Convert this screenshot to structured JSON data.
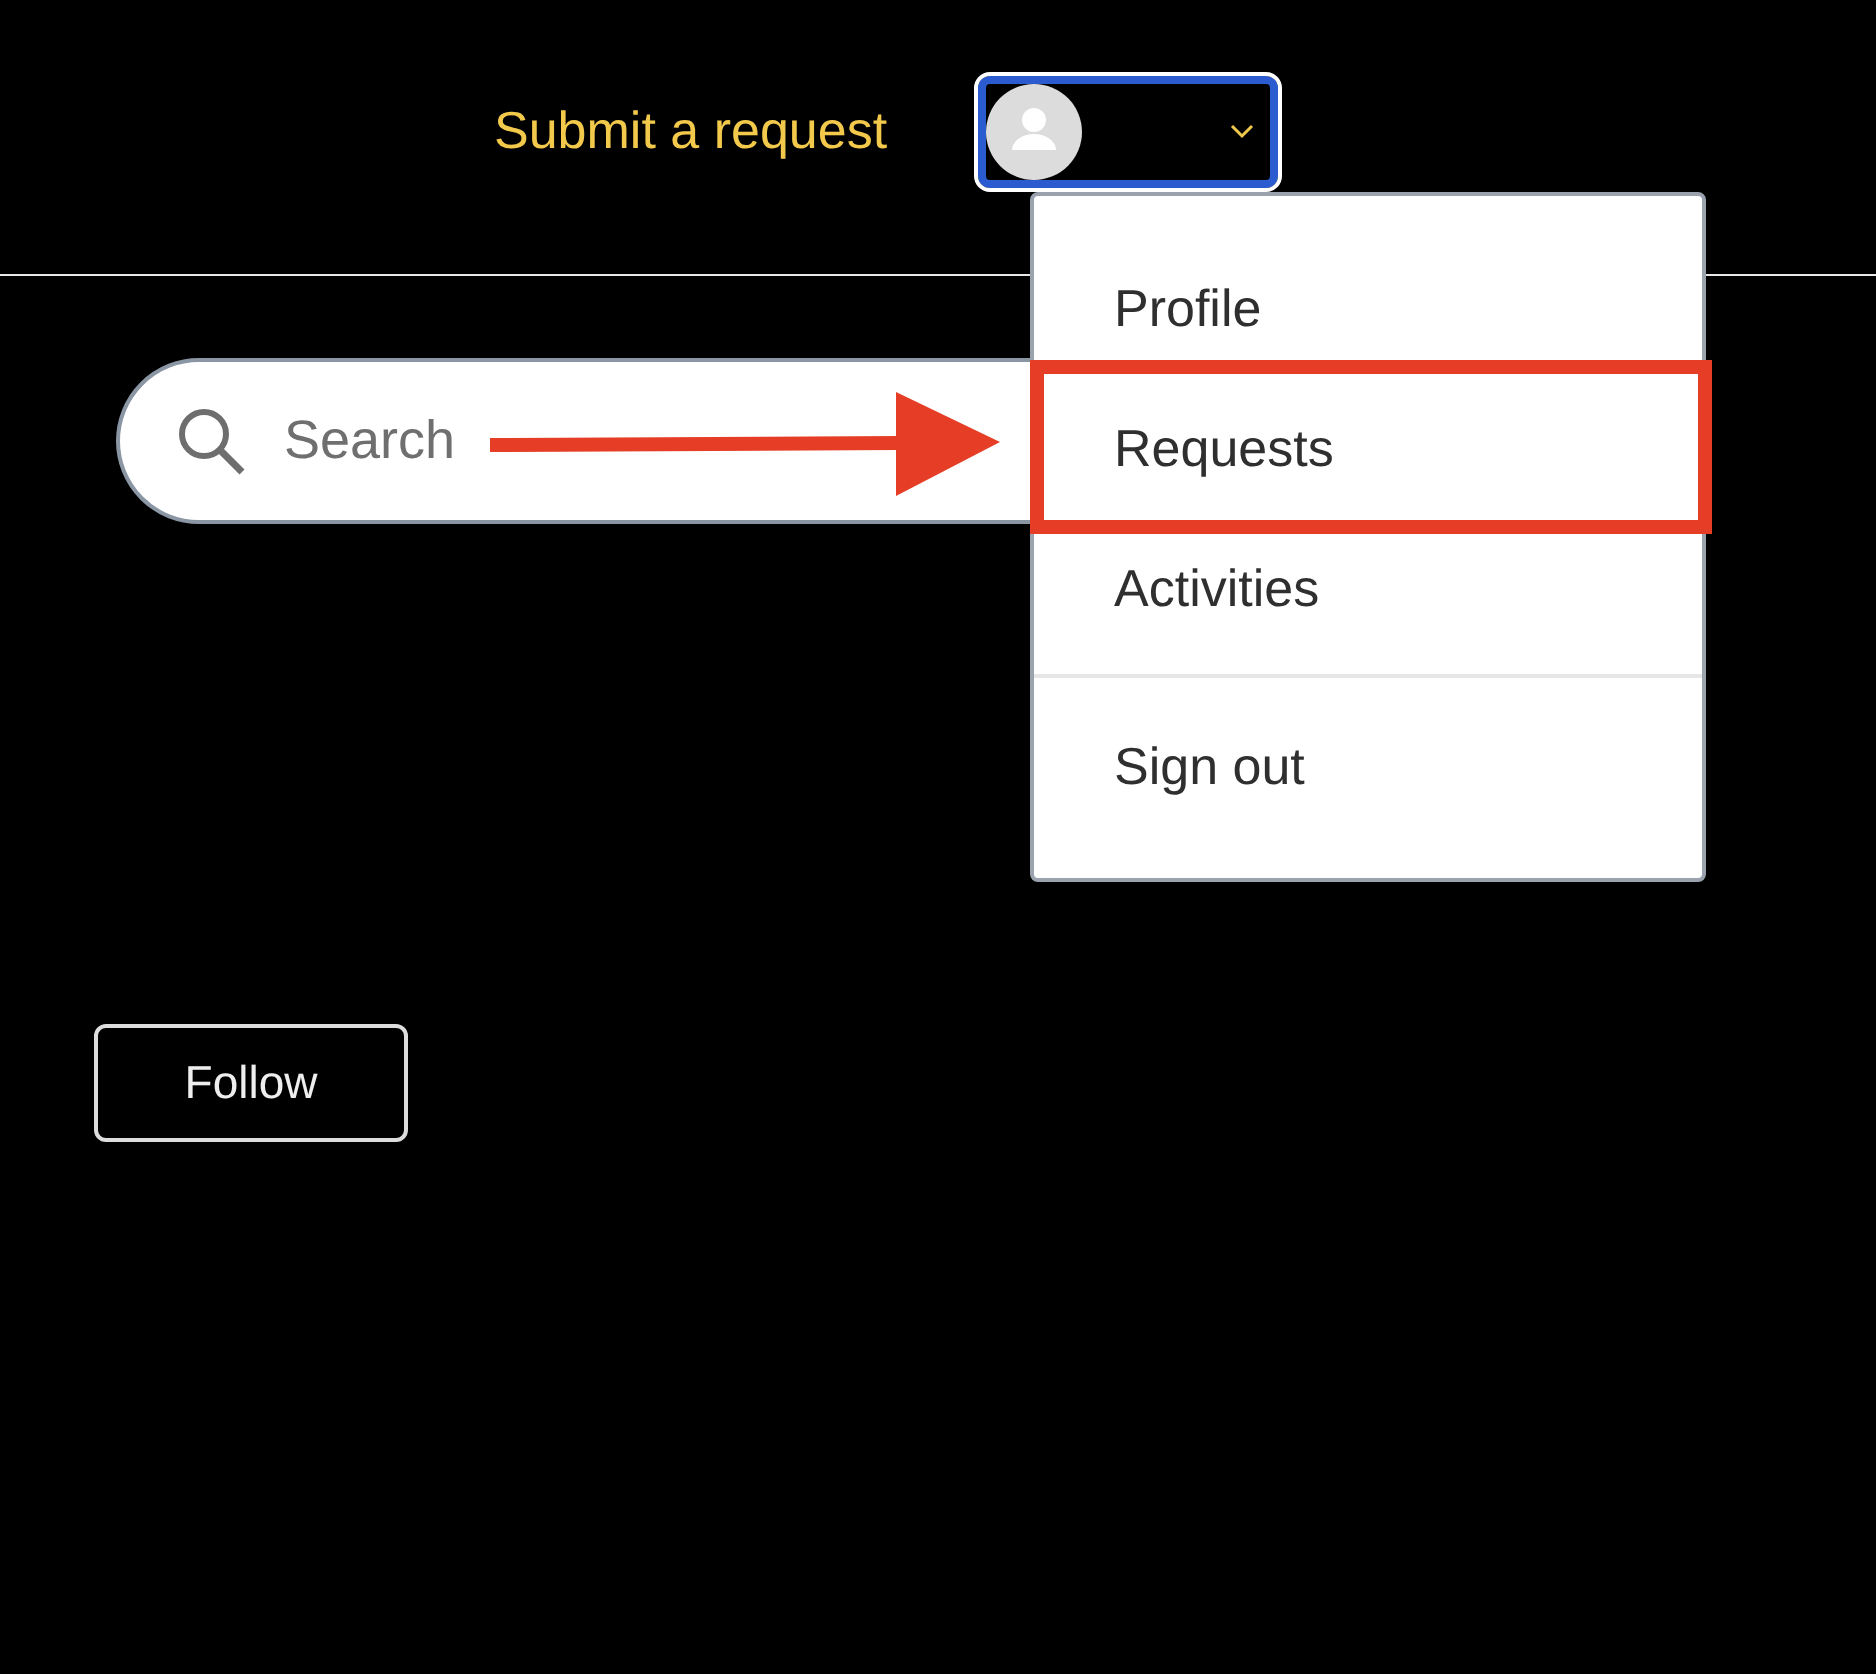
{
  "header": {
    "submit_link": "Submit a request"
  },
  "search": {
    "placeholder": "Search"
  },
  "user_menu": {
    "expanded": true,
    "items": [
      {
        "label": "Profile",
        "highlighted": false,
        "divider_before": false
      },
      {
        "label": "Requests",
        "highlighted": true,
        "divider_before": false
      },
      {
        "label": "Activities",
        "highlighted": false,
        "divider_before": false
      },
      {
        "label": "Sign out",
        "highlighted": false,
        "divider_before": true
      }
    ]
  },
  "follow_button": "Follow"
}
